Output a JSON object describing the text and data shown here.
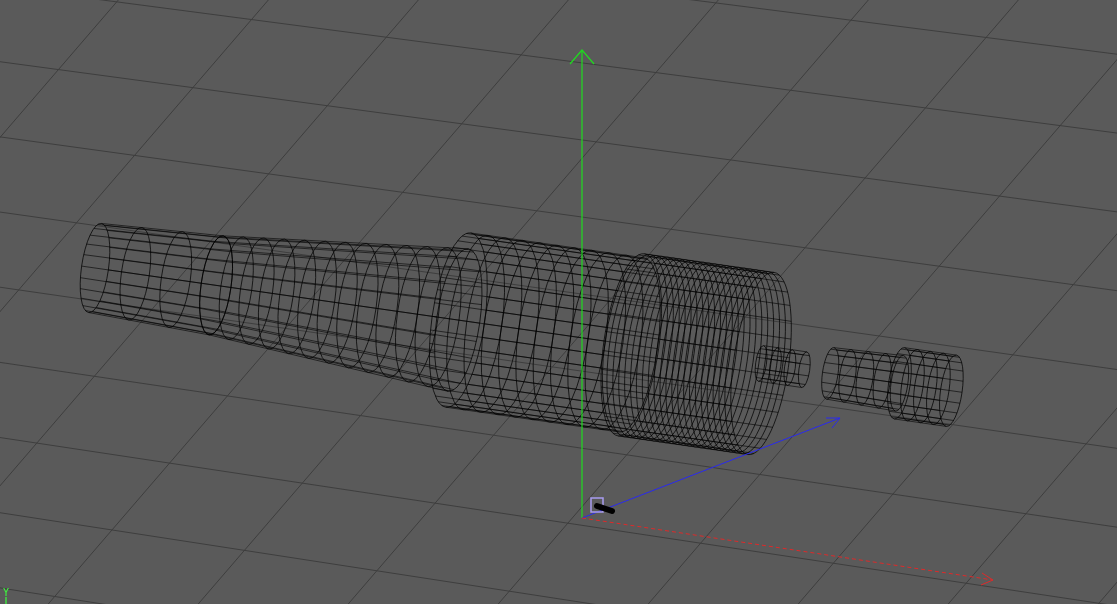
{
  "viewport": {
    "axis_label": "Y"
  }
}
